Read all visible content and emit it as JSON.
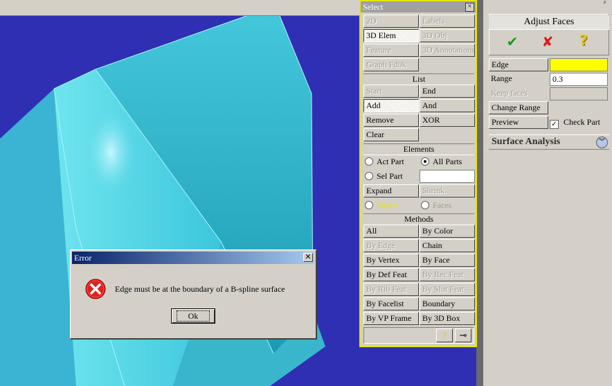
{
  "select_panel": {
    "title": "Select",
    "close_glyph": "×",
    "top_buttons": [
      {
        "label": "2D",
        "enabled": false
      },
      {
        "label": "Labels",
        "enabled": false
      },
      {
        "label": "3D Elem",
        "enabled": true,
        "pressed": true
      },
      {
        "label": "3D Obj",
        "enabled": false
      },
      {
        "label": "Feature",
        "enabled": false
      },
      {
        "label": "3D Annotations",
        "enabled": false
      },
      {
        "label": "Graph Fdbk",
        "enabled": false
      }
    ],
    "list_header": "List",
    "list_buttons": [
      {
        "label": "Start",
        "enabled": false
      },
      {
        "label": "End",
        "enabled": true
      },
      {
        "label": "Add",
        "enabled": true,
        "pressed": true
      },
      {
        "label": "And",
        "enabled": true
      },
      {
        "label": "Remove",
        "enabled": true
      },
      {
        "label": "XOR",
        "enabled": true
      },
      {
        "label": "Clear",
        "enabled": true
      }
    ],
    "elements_header": "Elements",
    "elements": {
      "act_part": "Act Part",
      "all_parts": "All Parts",
      "sel_part": "Sel Part",
      "sel_part_value": "",
      "expand": "Expand",
      "shrink": "Shrink",
      "edges": "Edges",
      "faces": "Faces"
    },
    "methods_header": "Methods",
    "methods": [
      {
        "label": "All",
        "enabled": true
      },
      {
        "label": "By Color",
        "enabled": true
      },
      {
        "label": "By Edge",
        "enabled": false
      },
      {
        "label": "Chain",
        "enabled": true
      },
      {
        "label": "By Vertex",
        "enabled": true
      },
      {
        "label": "By Face",
        "enabled": true
      },
      {
        "label": "By Def Feat",
        "enabled": true
      },
      {
        "label": "By Rec Feat",
        "enabled": false
      },
      {
        "label": "By Rib Feat",
        "enabled": false
      },
      {
        "label": "By Slot Feat",
        "enabled": false
      },
      {
        "label": "By Facelist",
        "enabled": true
      },
      {
        "label": "Boundary",
        "enabled": true
      },
      {
        "label": "By VP Frame",
        "enabled": true
      },
      {
        "label": "By 3D Box",
        "enabled": true
      }
    ]
  },
  "adjust_faces": {
    "pin_glyph": "ᵖ",
    "title": "Adjust Faces",
    "ok_icon": "check-icon",
    "cancel_icon": "cross-icon",
    "help_icon": "help-icon",
    "edge_label": "Edge",
    "edge_value": "",
    "edge_color": "#ffff00",
    "range_label": "Range",
    "range_value": "0.3",
    "keep_faces_label": "Keep faces",
    "change_range": "Change Range",
    "preview": "Preview",
    "check_part": "Check Part",
    "check_part_checked": true
  },
  "surface_analysis": {
    "label": "Surface Analysis"
  },
  "error_dialog": {
    "title": "Error",
    "message": "Edge must be at the boundary of a B-spline surface",
    "ok_label": "Ok"
  },
  "colors": {
    "viewport_bg": "#2f2fb4",
    "surface": "#5ad8e6",
    "panel_border": "#e6e600",
    "dialog_title": "#0a246a"
  }
}
